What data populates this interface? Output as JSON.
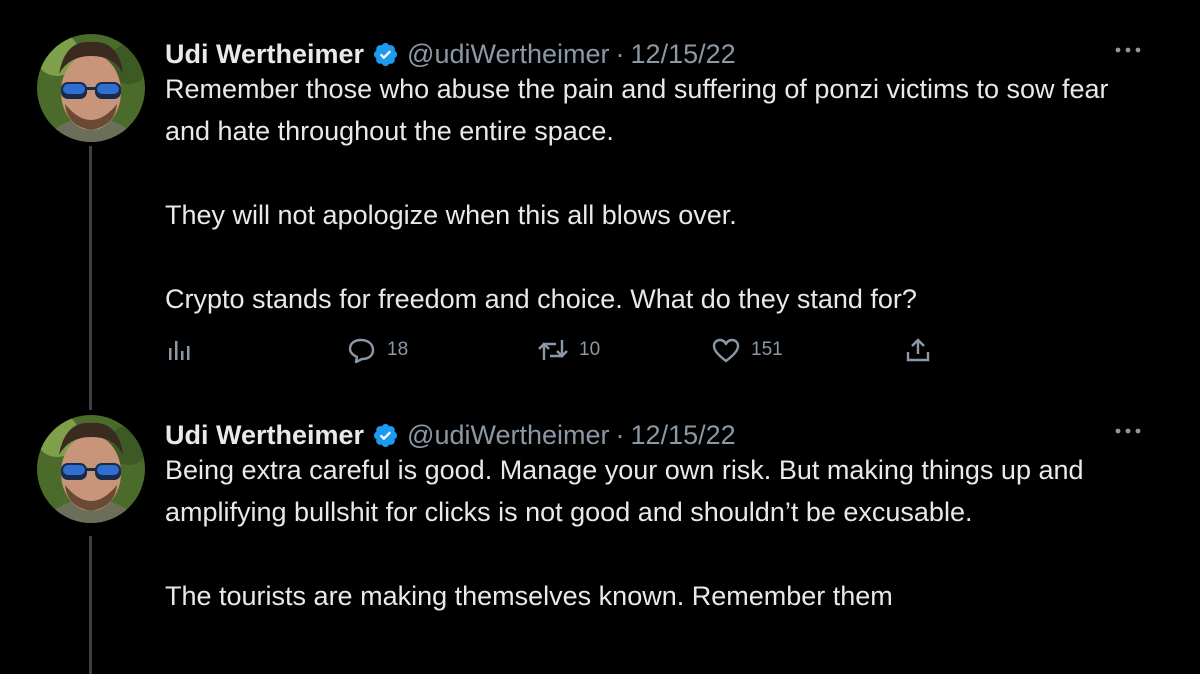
{
  "tweets": [
    {
      "author_name": "Udi Wertheimer",
      "handle": "@udiWertheimer",
      "separator": "·",
      "date": "12/15/22",
      "paragraphs": [
        "Remember those who abuse the pain and suffering of ponzi victims to sow fear and hate throughout the entire space.",
        "They will not apologize when this all blows over.",
        "Crypto stands for freedom and choice. What do they stand for?"
      ],
      "replies": "18",
      "retweets": "10",
      "likes": "151"
    },
    {
      "author_name": "Udi Wertheimer",
      "handle": "@udiWertheimer",
      "separator": "·",
      "date": "12/15/22",
      "paragraphs": [
        "Being extra careful is good. Manage your own risk. But making things up and amplifying bullshit for clicks is not good and shouldn’t be excusable.",
        "The tourists are making themselves known. Remember them"
      ]
    }
  ],
  "icons": {
    "verified": "verified-badge-icon",
    "more": "more-dots-icon",
    "views": "analytics-icon",
    "reply": "reply-icon",
    "retweet": "retweet-icon",
    "like": "heart-icon",
    "share": "share-icon"
  },
  "colors": {
    "background": "#000000",
    "text": "#e7e9ea",
    "secondary": "#8b98a5",
    "verified": "#1d9bf0",
    "thread_line": "#3c4043"
  }
}
